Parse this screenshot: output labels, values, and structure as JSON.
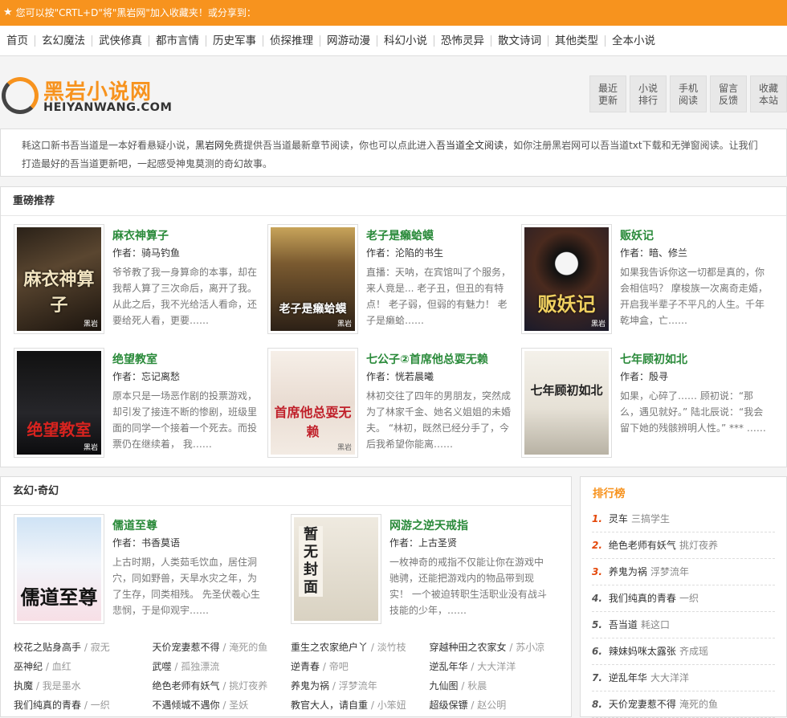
{
  "topbar": {
    "text": "您可以按\"CRTL+D\"将\"黑岩网\"加入收藏夹！或分享到："
  },
  "nav": [
    "首页",
    "玄幻魔法",
    "武侠修真",
    "都市言情",
    "历史军事",
    "侦探推理",
    "网游动漫",
    "科幻小说",
    "恐怖灵异",
    "散文诗词",
    "其他类型",
    "全本小说"
  ],
  "logo": {
    "cn": "黑岩小说网",
    "en": "HEIYANWANG.COM"
  },
  "quick": [
    {
      "l1": "最近",
      "l2": "更新"
    },
    {
      "l1": "小说",
      "l2": "排行"
    },
    {
      "l1": "手机",
      "l2": "阅读"
    },
    {
      "l1": "留言",
      "l2": "反馈"
    },
    {
      "l1": "收藏",
      "l2": "本站"
    }
  ],
  "intro": {
    "text1": "耗这口新书吾当道是一本好看悬疑小说，",
    "link1": "黑岩网",
    "text2": "免费提供吾当道最新章节阅读，你也可以点此进入",
    "link2": "吾当道全文阅读",
    "text3": "，如你注册黑岩网可以吾当道txt下载和无弹窗阅读。让我们打造最好的吾当道更新吧，一起感受神鬼莫测的奇幻故事。"
  },
  "recommend": {
    "title": "重磅推荐",
    "books": [
      {
        "title": "麻衣神算子",
        "author_label": "作者：",
        "author": "骑马钓鱼",
        "desc": "爷爷教了我一身算命的本事，却在我帮人算了三次命后，离开了我。从此之后，我不光给活人看命，还要给死人看，更要……",
        "cover": "麻衣神算子",
        "brand": "黑岩"
      },
      {
        "title": "老子是癞蛤蟆",
        "author_label": "作者：",
        "author": "沦陷的书生",
        "desc": "直播：天呐，在宾馆叫了个服务，来人竟是... 老子丑，但丑的有特点！ 老子弱，但弱的有魅力！ 老子是癞蛤……",
        "cover": "老子是癞蛤蟆",
        "brand": "黑岩"
      },
      {
        "title": "贩妖记",
        "author_label": "作者：",
        "author": "暗、修兰",
        "desc": "如果我告诉你这一切都是真的，你会相信吗？ 摩梭族一次离奇走婚，开启我半辈子不平凡的人生。千年乾坤盒，亡……",
        "cover": "贩妖记",
        "brand": "黑岩"
      },
      {
        "title": "绝望教室",
        "author_label": "作者：",
        "author": "忘记离愁",
        "desc": "原本只是一场恶作剧的投票游戏，却引发了接连不断的惨剧，班级里面的同学一个接着一个死去。而投票仍在继续着， 我……",
        "cover": "绝望教室",
        "brand": "黑岩"
      },
      {
        "title": "七公子②首席他总耍无赖",
        "author_label": "作者：",
        "author": "恍若晨曦",
        "desc": "林初交往了四年的男朋友，突然成为了林家千金、她名义姐姐的未婚夫。 “林初，既然已经分手了，今后我希望你能离……",
        "cover": "首席他总耍无赖",
        "brand": "黑岩"
      },
      {
        "title": "七年顾初如北",
        "author_label": "作者：",
        "author": "殷寻",
        "desc": "如果，心碎了…… 顾初说：“那么，遇见就好。” 陆北辰说：“我会留下她的残骸辨明人性。” *** ……",
        "cover": "七年顾初如北",
        "brand": ""
      }
    ]
  },
  "fantasy": {
    "title": "玄幻·奇幻",
    "books": [
      {
        "title": "儒道至尊",
        "author_label": "作者：",
        "author": "书香莫语",
        "desc": "上古时期，人类茹毛饮血，居住洞穴，同如野兽，天旱水灾之年，为了生存，同类相残。 先圣伏羲心生悲悯，于是仰观宇……",
        "cover": "儒道至尊"
      },
      {
        "title": "网游之逆天戒指",
        "author_label": "作者：",
        "author": "上古圣贤",
        "desc": "一枚神奇的戒指不仅能让你在游戏中驰骋，还能把游戏内的物品带到现实！ 一个被迫转职生活职业没有战斗技能的少年，……",
        "cover": "暂无封面"
      }
    ],
    "links": [
      [
        {
          "t": "校花之贴身高手",
          "a": "寂无"
        },
        {
          "t": "天价宠妻惹不得",
          "a": "淹死的鱼"
        },
        {
          "t": "重生之农家绝户丫",
          "a": "淡竹枝"
        },
        {
          "t": "穿越种田之农家女",
          "a": "苏小凉"
        }
      ],
      [
        {
          "t": "巫神纪",
          "a": "血红"
        },
        {
          "t": "武噬",
          "a": "孤独漂流"
        },
        {
          "t": "逆青春",
          "a": "帝吧"
        },
        {
          "t": "逆乱年华",
          "a": "大大洋洋"
        }
      ],
      [
        {
          "t": "执魔",
          "a": "我是墨水"
        },
        {
          "t": "绝色老师有妖气",
          "a": "挑灯夜养"
        },
        {
          "t": "养鬼为祸",
          "a": "浮梦流年"
        },
        {
          "t": "九仙图",
          "a": "秋晨"
        }
      ],
      [
        {
          "t": "我们纯真的青春",
          "a": "一织"
        },
        {
          "t": "不遇倾城不遇你",
          "a": "圣妖"
        },
        {
          "t": "教官大人，请自重",
          "a": "小笨妞"
        },
        {
          "t": "超级保镖",
          "a": "赵公明"
        }
      ]
    ]
  },
  "ranking": {
    "title": "排行榜",
    "items": [
      {
        "n": "1.",
        "t": "灵车",
        "a": "三搞学生"
      },
      {
        "n": "2.",
        "t": "绝色老师有妖气",
        "a": "挑灯夜养"
      },
      {
        "n": "3.",
        "t": "养鬼为祸",
        "a": "浮梦流年"
      },
      {
        "n": "4.",
        "t": "我们纯真的青春",
        "a": "一织"
      },
      {
        "n": "5.",
        "t": "吾当道",
        "a": "耗这口"
      },
      {
        "n": "6.",
        "t": "辣妹妈咪太露张",
        "a": "齐成瑶"
      },
      {
        "n": "7.",
        "t": "逆乱年华",
        "a": "大大洋洋"
      },
      {
        "n": "8.",
        "t": "天价宠妻惹不得",
        "a": "淹死的鱼"
      }
    ]
  }
}
